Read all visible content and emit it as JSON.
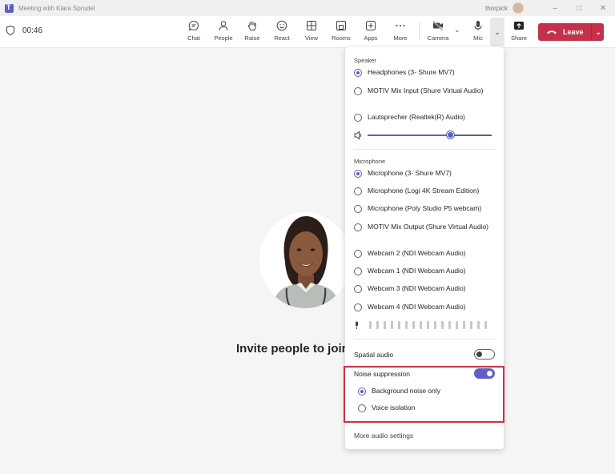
{
  "window": {
    "title": "Meeting with Klara Sprudel",
    "user": "thorpick"
  },
  "toolbar": {
    "timer": "00:46",
    "buttons": {
      "chat": "Chat",
      "people": "People",
      "raise": "Raise",
      "react": "React",
      "view": "View",
      "rooms": "Rooms",
      "apps": "Apps",
      "more": "More",
      "camera": "Camera",
      "mic": "Mic",
      "share": "Share",
      "leave": "Leave"
    }
  },
  "stage": {
    "invite_text": "Invite people to join"
  },
  "device_panel": {
    "speaker": {
      "heading": "Speaker",
      "options": [
        "Headphones (3- Shure MV7)",
        "MOTIV Mix Input (Shure Virtual Audio)",
        "Lautsprecher (Realtek(R) Audio)"
      ],
      "selected_index": 0,
      "volume_level": 0.67
    },
    "microphone": {
      "heading": "Microphone",
      "options": [
        "Microphone (3- Shure MV7)",
        "Microphone (Logi 4K Stream Edition)",
        "Microphone (Poly Studio P5 webcam)",
        "MOTIV Mix Output (Shure Virtual Audio)",
        "Webcam 2 (NDI Webcam Audio)",
        "Webcam 1 (NDI Webcam Audio)",
        "Webcam 3 (NDI Webcam Audio)",
        "Webcam 4 (NDI Webcam Audio)"
      ],
      "selected_index": 0,
      "input_level": 0
    },
    "spatial_audio": {
      "label": "Spatial audio",
      "enabled": false
    },
    "noise_suppression": {
      "label": "Noise suppression",
      "enabled": true,
      "options": [
        "Background noise only",
        "Voice isolation"
      ],
      "selected_index": 0
    },
    "more_settings": "More audio settings"
  },
  "colors": {
    "accent": "#5b5fc7",
    "leave": "#c4314b",
    "highlight": "#d32f3c"
  }
}
